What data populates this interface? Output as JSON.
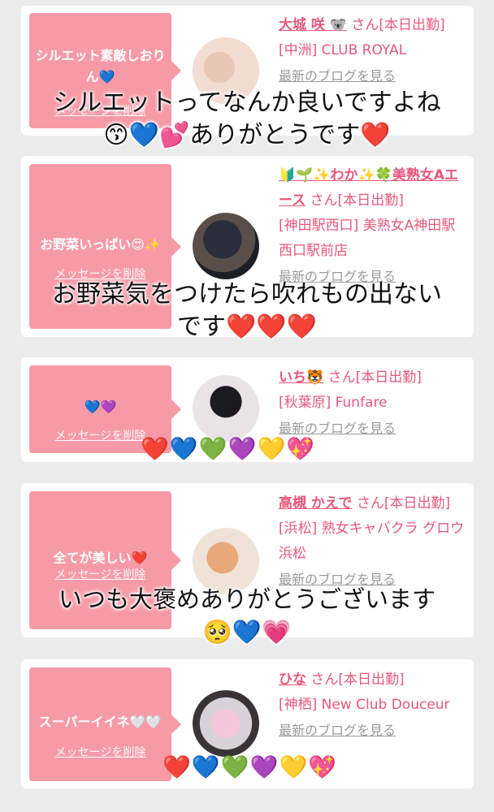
{
  "cards": [
    {
      "bubble_text": "シルエット素敵しおりん💙",
      "delete_label": "メッセージを削除",
      "name": "大城 咲 🐨",
      "san_suffix": " さん[本日出勤]",
      "shop": "[中洲] CLUB ROYAL",
      "blog_label": "最新のブログを見る"
    },
    {
      "bubble_text": "お野菜いっぱい😍✨",
      "delete_label": "メッセージを削除",
      "name": "🔰🌱✨わか✨🍀美熟女Aエース",
      "san_suffix": " さん[本日出勤]",
      "shop": "[神田駅西口] 美熟女A神田駅西口駅前店",
      "blog_label": "最新のブログを見る"
    },
    {
      "bubble_text": "💙💜",
      "delete_label": "メッセージを削除",
      "name": "いち🐯",
      "san_suffix": " さん[本日出勤]",
      "shop": "[秋葉原] Funfare",
      "blog_label": "最新のブログを見る"
    },
    {
      "bubble_text": "全てが美しい❤️",
      "delete_label": "メッセージを削除",
      "name": "高槻 かえで",
      "san_suffix": " さん[本日出勤]",
      "shop": "[浜松] 熟女キャバクラ グロウ 浜松",
      "blog_label": "最新のブログを見る"
    },
    {
      "bubble_text": "スーパーイイネ🤍🤍",
      "delete_label": "メッセージを削除",
      "name": "ひな",
      "san_suffix": " さん[本日出勤]",
      "shop": "[神栖] New Club Douceur",
      "blog_label": "最新のブログを見る"
    }
  ],
  "overlays": {
    "card0_line1": "シルエットってなんか良いですよね",
    "card0_line2": "😙💙💕ありがとうです❤️",
    "card1_line1": "お野菜気をつけたら吹れもの出ない",
    "card1_line2": "です❤️❤️❤️",
    "card2_emojis": "❤️💙💚💜💛💖",
    "card3_line1": "いつも大褒めありがとうございます",
    "card3_line2": "🥺💙💗",
    "card4_emojis": "❤️💙💚💜💛💖"
  }
}
